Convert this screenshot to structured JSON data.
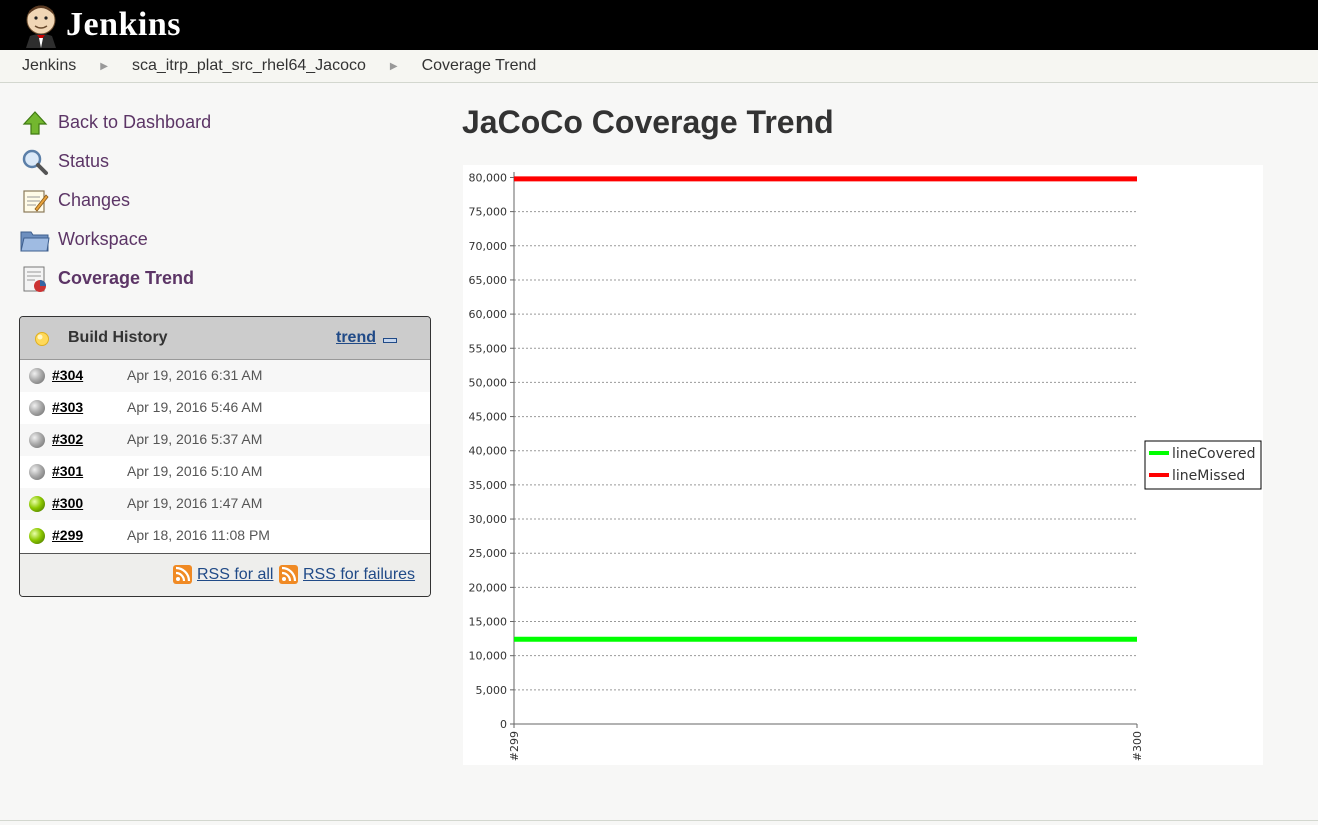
{
  "header": {
    "brand": "Jenkins"
  },
  "breadcrumb": [
    "Jenkins",
    "sca_itrp_plat_src_rhel64_Jacoco",
    "Coverage Trend"
  ],
  "sidebar": {
    "items": [
      {
        "label": "Back to Dashboard",
        "icon": "up-arrow-icon"
      },
      {
        "label": "Status",
        "icon": "magnifier-icon"
      },
      {
        "label": "Changes",
        "icon": "notepad-icon"
      },
      {
        "label": "Workspace",
        "icon": "folder-icon"
      },
      {
        "label": "Coverage Trend",
        "icon": "chart-icon"
      }
    ]
  },
  "build_history": {
    "title": "Build History",
    "trend_label": "trend",
    "builds": [
      {
        "number": "#304",
        "date": "Apr 19, 2016 6:31 AM",
        "status": "grey"
      },
      {
        "number": "#303",
        "date": "Apr 19, 2016 5:46 AM",
        "status": "grey"
      },
      {
        "number": "#302",
        "date": "Apr 19, 2016 5:37 AM",
        "status": "grey"
      },
      {
        "number": "#301",
        "date": "Apr 19, 2016 5:10 AM",
        "status": "grey"
      },
      {
        "number": "#300",
        "date": "Apr 19, 2016 1:47 AM",
        "status": "green"
      },
      {
        "number": "#299",
        "date": "Apr 18, 2016 11:08 PM",
        "status": "green"
      }
    ],
    "rss_all": "RSS for all",
    "rss_failures": "RSS for failures"
  },
  "main": {
    "title": "JaCoCo Coverage Trend"
  },
  "chart_data": {
    "type": "line",
    "categories": [
      "#299",
      "#300"
    ],
    "series": [
      {
        "name": "lineCovered",
        "values": [
          12400,
          12400
        ],
        "color": "#00ff00"
      },
      {
        "name": "lineMissed",
        "values": [
          79800,
          79800
        ],
        "color": "#ff0000"
      }
    ],
    "yticks": [
      0,
      5000,
      10000,
      15000,
      20000,
      25000,
      30000,
      35000,
      40000,
      45000,
      50000,
      55000,
      60000,
      65000,
      70000,
      75000,
      80000
    ],
    "ytick_labels": [
      "0",
      "5,000",
      "10,000",
      "15,000",
      "20,000",
      "25,000",
      "30,000",
      "35,000",
      "40,000",
      "45,000",
      "50,000",
      "55,000",
      "60,000",
      "65,000",
      "70,000",
      "75,000",
      "80,000"
    ],
    "ylim": [
      0,
      80000
    ],
    "grid": true,
    "legend_position": "right"
  }
}
